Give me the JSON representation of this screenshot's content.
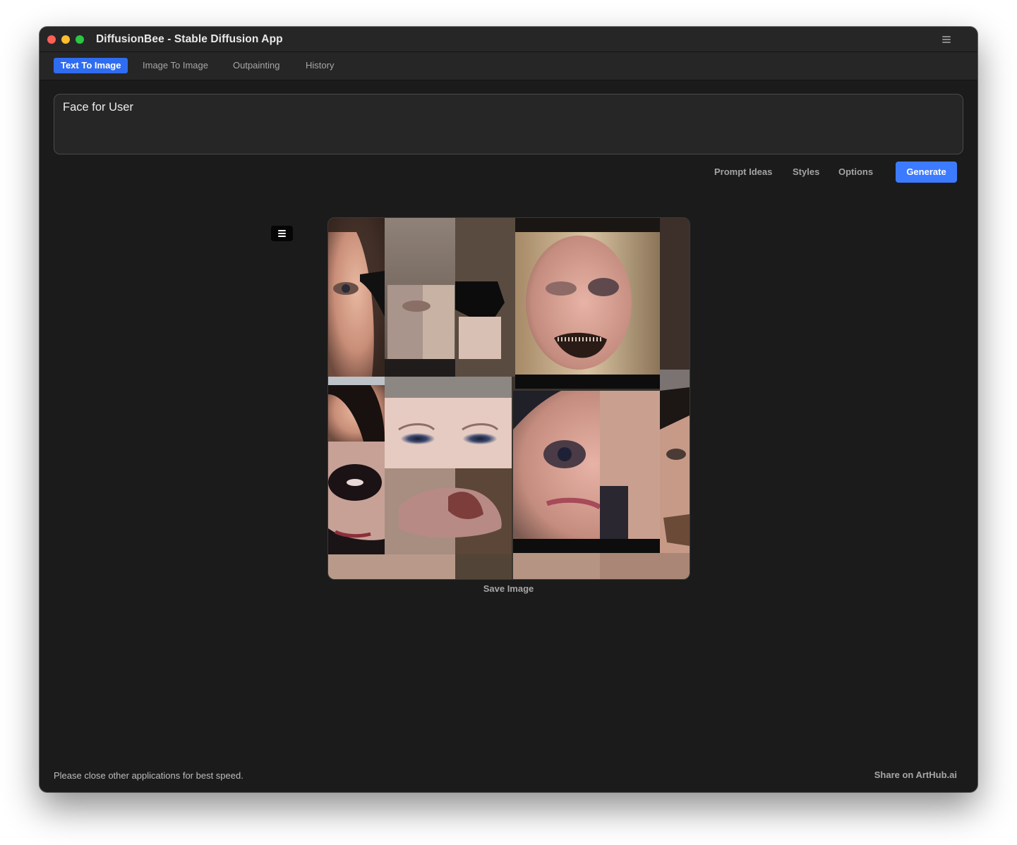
{
  "window": {
    "title": "DiffusionBee - Stable Diffusion App",
    "menu_icon": "hamburger-menu-icon"
  },
  "tabs": [
    {
      "label": "Text To Image",
      "active": true
    },
    {
      "label": "Image To Image",
      "active": false
    },
    {
      "label": "Outpainting",
      "active": false
    },
    {
      "label": "History",
      "active": false
    }
  ],
  "prompt": {
    "value": "Face for User"
  },
  "actions": {
    "prompt_ideas": "Prompt Ideas",
    "styles": "Styles",
    "options": "Options",
    "generate": "Generate"
  },
  "result": {
    "menu_icon": "hamburger-menu-icon",
    "image_description": "generated-face-collage",
    "save_label": "Save Image"
  },
  "footer": {
    "status": "Please close other applications for best speed.",
    "share_link": "Share on ArtHub.ai"
  },
  "colors": {
    "accent": "#3c7bff",
    "active_tab": "#2f6cf0",
    "background": "#1b1b1b",
    "toolbar": "#262626"
  }
}
